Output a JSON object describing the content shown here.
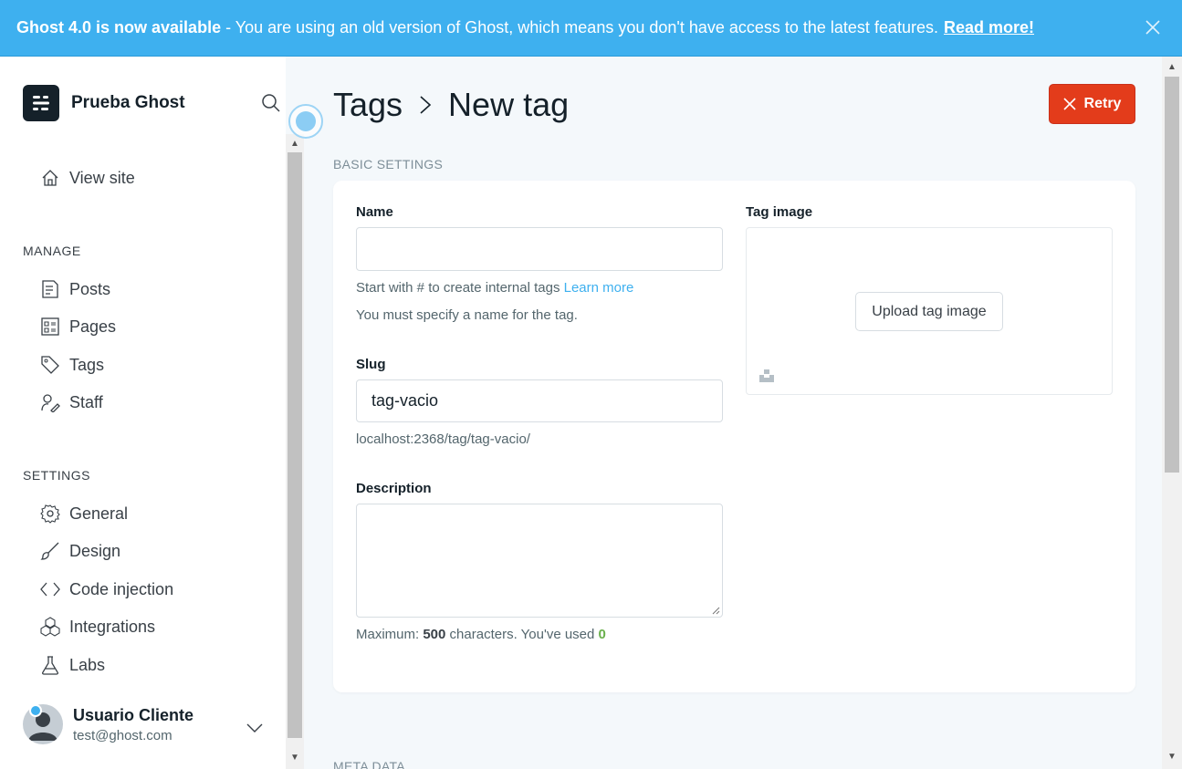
{
  "banner": {
    "title": "Ghost 4.0 is now available",
    "message": "- You are using an old version of Ghost, which means you don't have access to the latest features.",
    "link": "Read more!"
  },
  "sidebar": {
    "brand": "Prueba Ghost",
    "view_site": "View site",
    "manage_title": "MANAGE",
    "manage_items": [
      "Posts",
      "Pages",
      "Tags",
      "Staff"
    ],
    "settings_title": "SETTINGS",
    "settings_items": [
      "General",
      "Design",
      "Code injection",
      "Integrations",
      "Labs"
    ],
    "user": {
      "name": "Usuario Cliente",
      "email": "test@ghost.com"
    }
  },
  "main": {
    "breadcrumb_parent": "Tags",
    "breadcrumb_current": "New tag",
    "retry_label": "Retry",
    "basic_settings": "BASIC SETTINGS",
    "meta_data": "META DATA",
    "name_label": "Name",
    "name_value": "",
    "name_hint": "Start with # to create internal tags",
    "learn_more": "Learn more",
    "name_error": "You must specify a name for the tag.",
    "slug_label": "Slug",
    "slug_value": "tag-vacio",
    "slug_url": "localhost:2368/tag/tag-vacio/",
    "description_label": "Description",
    "description_value": "",
    "desc_hint_prefix": "Maximum:",
    "desc_max": "500",
    "desc_hint_middle": "characters. You've used",
    "desc_used": "0",
    "tag_image_label": "Tag image",
    "upload_label": "Upload tag image"
  },
  "colors": {
    "banner": "#3eb0ef",
    "retry": "#e33c1b",
    "link": "#3eb0ef",
    "count_green": "#6ab04c"
  }
}
